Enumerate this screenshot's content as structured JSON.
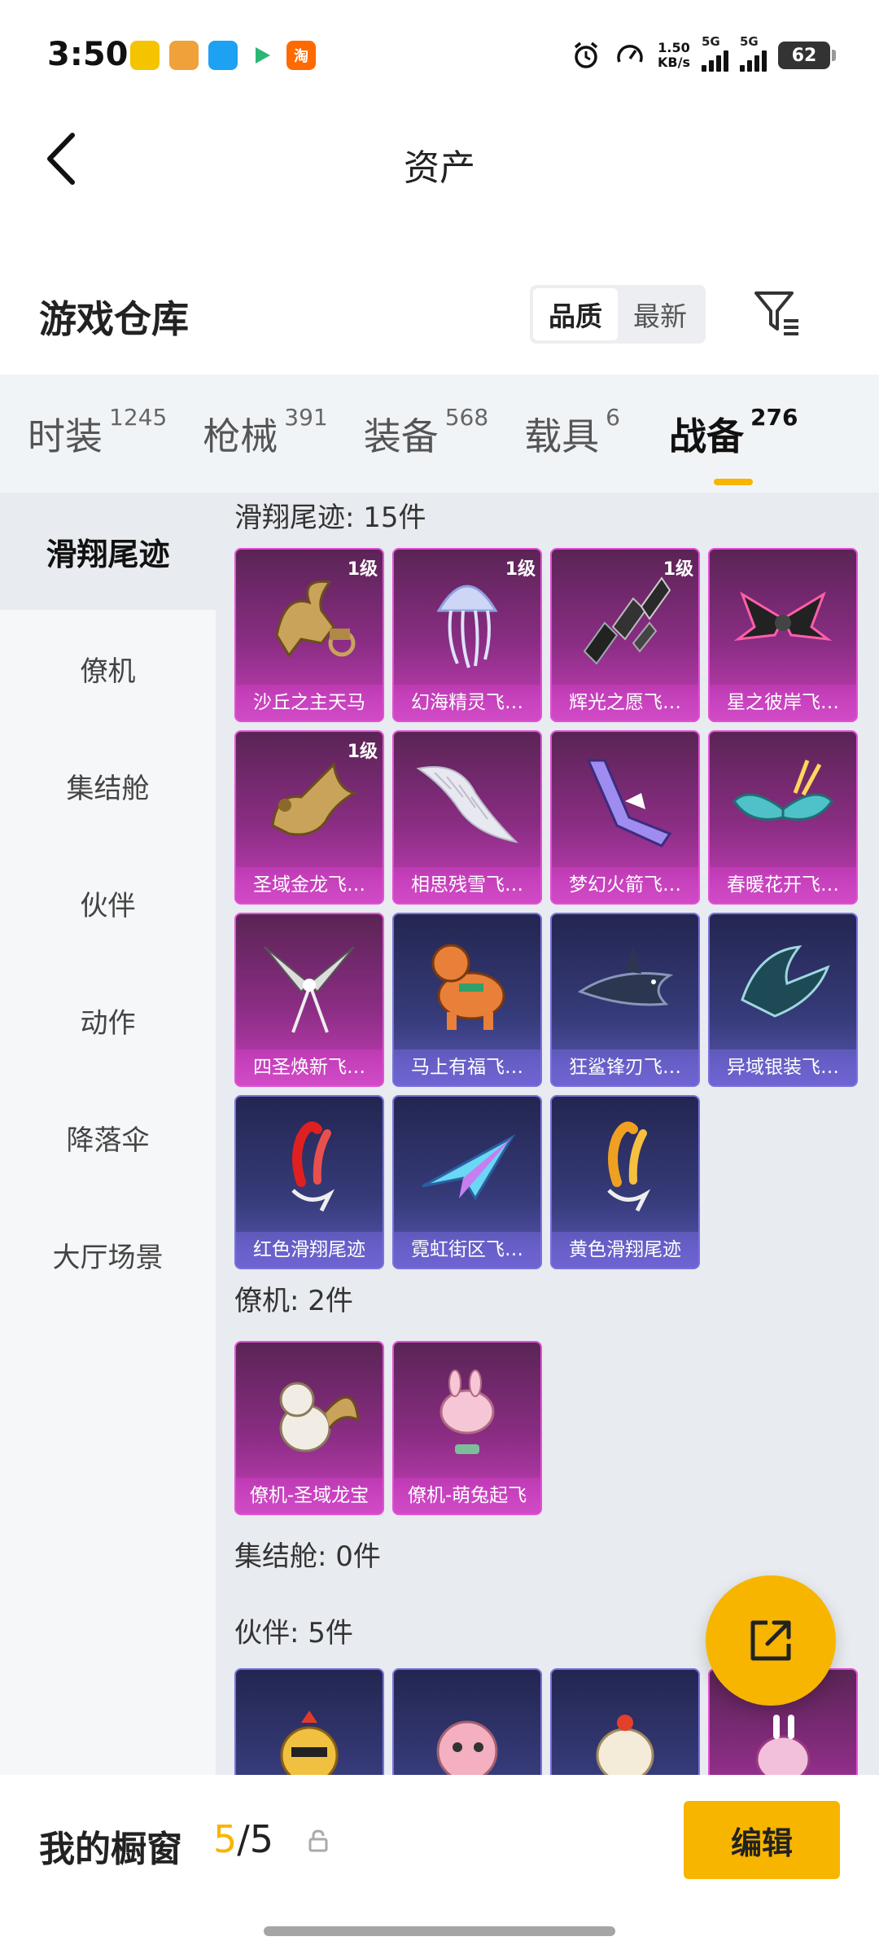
{
  "status_bar": {
    "time": "3:50",
    "speed_value": "1.50",
    "speed_unit": "KB/s",
    "network_1": "5G",
    "network_2": "5G",
    "battery": "62",
    "app_淘": "淘"
  },
  "header": {
    "title": "资产"
  },
  "warehouse": {
    "title": "游戏仓库",
    "sort_options": [
      "品质",
      "最新"
    ],
    "sort_selected": "品质"
  },
  "tabs": [
    {
      "label": "时装",
      "count": "1245"
    },
    {
      "label": "枪械",
      "count": "391"
    },
    {
      "label": "装备",
      "count": "568"
    },
    {
      "label": "载具",
      "count": "6"
    },
    {
      "label": "战备",
      "count": "276",
      "active": true
    }
  ],
  "sidebar": [
    {
      "label": "滑翔尾迹",
      "active": true
    },
    {
      "label": "僚机"
    },
    {
      "label": "集结舱"
    },
    {
      "label": "伙伴"
    },
    {
      "label": "动作"
    },
    {
      "label": "降落伞"
    },
    {
      "label": "大厅场景"
    }
  ],
  "sections": {
    "glide": {
      "title": "滑翔尾迹: 15件",
      "items": [
        {
          "name": "沙丘之主天马",
          "level": "1级",
          "rarity": "purple",
          "icon": "pegasus-chariot-icon"
        },
        {
          "name": "幻海精灵飞…",
          "level": "1级",
          "rarity": "purple",
          "icon": "jellyfish-icon"
        },
        {
          "name": "辉光之愿飞…",
          "level": "1级",
          "rarity": "purple",
          "icon": "crystal-shards-icon"
        },
        {
          "name": "星之彼岸飞…",
          "level": "",
          "rarity": "purple",
          "icon": "dark-wing-icon"
        },
        {
          "name": "圣域金龙飞…",
          "level": "1级",
          "rarity": "purple",
          "icon": "golden-dragon-icon"
        },
        {
          "name": "相思残雪飞…",
          "level": "",
          "rarity": "purple",
          "icon": "feather-wing-icon"
        },
        {
          "name": "梦幻火箭飞…",
          "level": "",
          "rarity": "purple",
          "icon": "rocket-glider-icon"
        },
        {
          "name": "春暖花开飞…",
          "level": "",
          "rarity": "purple",
          "icon": "butterfly-wing-icon"
        },
        {
          "name": "四圣焕新飞…",
          "level": "",
          "rarity": "purple",
          "icon": "blade-wing-icon"
        },
        {
          "name": "马上有福飞…",
          "level": "",
          "rarity": "blue",
          "icon": "toy-horse-icon"
        },
        {
          "name": "狂鲨锋刃飞…",
          "level": "",
          "rarity": "blue",
          "icon": "shark-glider-icon"
        },
        {
          "name": "异域银装飞…",
          "level": "",
          "rarity": "blue",
          "icon": "silver-wing-icon"
        },
        {
          "name": "红色滑翔尾迹",
          "level": "",
          "rarity": "blue",
          "icon": "red-smoke-icon"
        },
        {
          "name": "霓虹街区飞…",
          "level": "",
          "rarity": "blue",
          "icon": "neon-paper-plane-icon"
        },
        {
          "name": "黄色滑翔尾迹",
          "level": "",
          "rarity": "blue",
          "icon": "yellow-smoke-icon"
        }
      ]
    },
    "drone": {
      "title": "僚机: 2件",
      "items": [
        {
          "name": "僚机-圣域龙宝",
          "level": "",
          "rarity": "purple",
          "icon": "baby-dragon-icon"
        },
        {
          "name": "僚机-萌兔起飞",
          "level": "",
          "rarity": "purple",
          "icon": "bunny-drone-icon"
        }
      ]
    },
    "capsule": {
      "title": "集结舱: 0件"
    },
    "partner": {
      "title": "伙伴: 5件",
      "items": [
        {
          "rarity": "blue",
          "icon": "chicken-partner-icon"
        },
        {
          "rarity": "blue",
          "icon": "pink-bird-partner-icon"
        },
        {
          "rarity": "blue",
          "icon": "egg-partner-icon"
        },
        {
          "rarity": "blue",
          "icon": "rabbit-robot-partner-icon"
        }
      ]
    }
  },
  "bottom": {
    "label": "我的橱窗",
    "current": "5",
    "separator": "/",
    "total": "5",
    "edit_label": "编辑"
  },
  "colors": {
    "accent": "#f7b500",
    "purple_card": "#c640b9",
    "blue_card": "#5b58b5"
  }
}
